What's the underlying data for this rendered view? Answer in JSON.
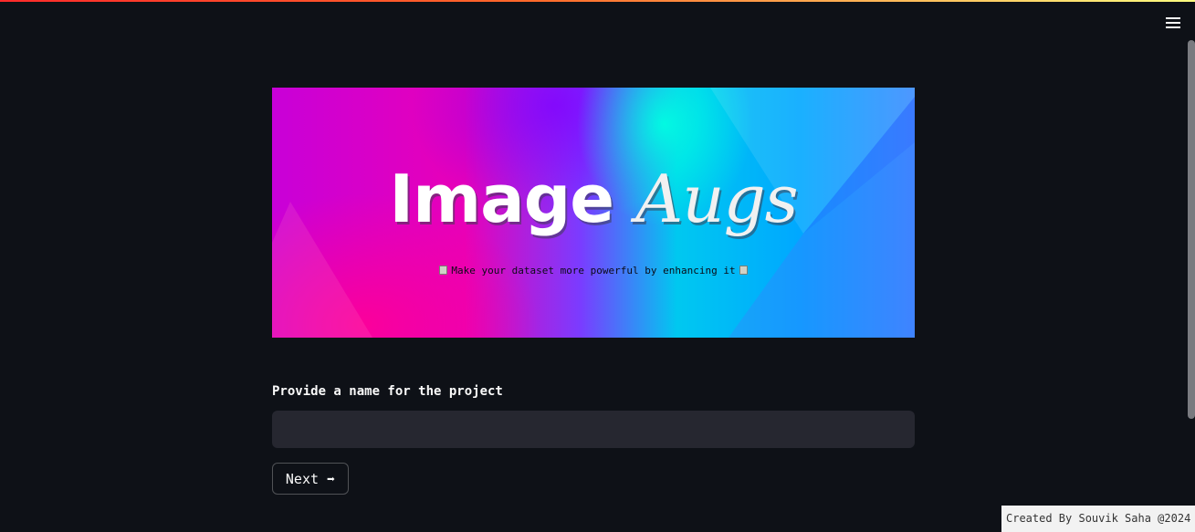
{
  "header": {
    "menu_icon": "hamburger-menu-icon"
  },
  "banner": {
    "title_part1": "Image",
    "title_part2": "Augs",
    "subtitle": "Make your dataset more powerful by enhancing it",
    "emoji_icon": "robot-icon",
    "colors": {
      "magenta": "#e800b8",
      "purple": "#7a3cff",
      "cyan": "#00ffe1",
      "blue": "#00a8ff"
    }
  },
  "form": {
    "label": "Provide a name for the project",
    "input_value": "",
    "input_placeholder": "",
    "next_label": "Next ➡"
  },
  "footer": {
    "text": "Created By Souvik Saha @2024"
  },
  "theme": {
    "background": "#0e1117",
    "input_bg": "#262730",
    "text": "#fafafa"
  }
}
